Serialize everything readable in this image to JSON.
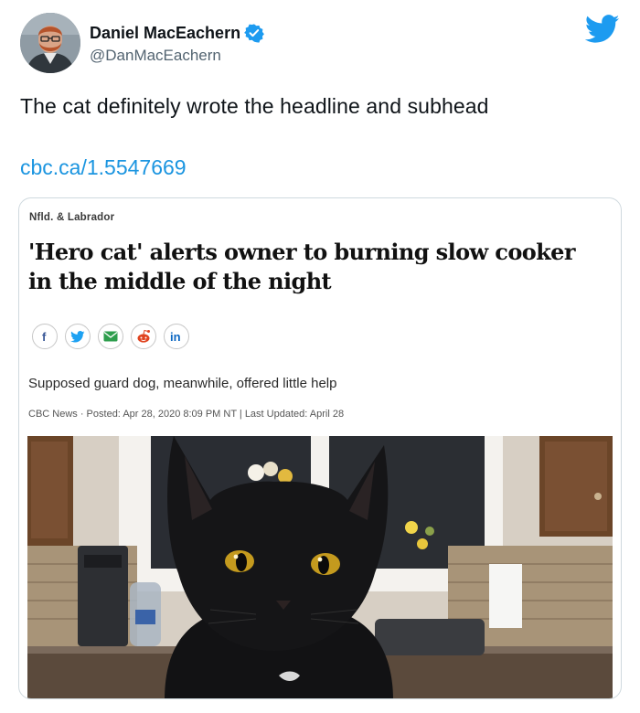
{
  "tweet": {
    "author_name": "Daniel MacEachern",
    "handle": "@DanMacEachern",
    "text": "The cat definitely wrote the headline and subhead",
    "link": "cbc.ca/1.5547669"
  },
  "card": {
    "section": "Nfld. & Labrador",
    "headline": "'Hero cat' alerts owner to burning slow cooker in the middle of the night",
    "share_icons": [
      "facebook-icon",
      "twitter-icon",
      "email-icon",
      "reddit-icon",
      "linkedin-icon"
    ],
    "subhead": "Supposed guard dog, meanwhile, offered little help",
    "byline": "CBC News · Posted: Apr 28, 2020 8:09 PM NT | Last Updated: April 28"
  },
  "colors": {
    "twitter_blue": "#1d9bf0",
    "link_blue": "#1b95e0",
    "facebook_blue": "#3b5998",
    "email_green": "#2e9e4d",
    "reddit_red": "#e0431f",
    "linkedin_blue": "#0a66c2"
  }
}
